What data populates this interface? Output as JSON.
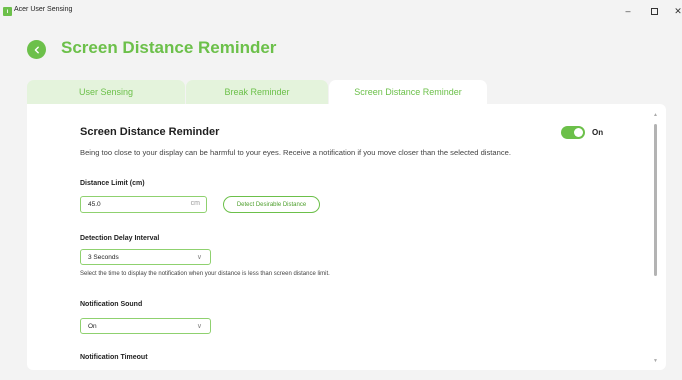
{
  "window": {
    "title": "Acer User Sensing",
    "minimize_glyph": "–",
    "close_glyph": "✕"
  },
  "header": {
    "back_glyph": "‹",
    "title": "Screen Distance Reminder"
  },
  "tabs": [
    {
      "label": "User Sensing",
      "active": false
    },
    {
      "label": "Break Reminder",
      "active": false
    },
    {
      "label": "Screen Distance Reminder",
      "active": true
    }
  ],
  "section": {
    "title": "Screen Distance Reminder",
    "toggle_label": "On",
    "toggle_on": true,
    "description": "Being too close to your display can be harmful to your eyes. Receive a notification if you move closer than the selected distance."
  },
  "distance_limit": {
    "label": "Distance Limit (cm)",
    "value": "45.0",
    "unit": "cm",
    "detect_button": "Detect Desirable Distance"
  },
  "detection_delay": {
    "label": "Detection Delay Interval",
    "selected": "3 Seconds",
    "hint": "Select the time to display the notification when your distance is less than screen distance limit."
  },
  "notification_sound": {
    "label": "Notification Sound",
    "selected": "On"
  },
  "notification_timeout": {
    "label": "Notification Timeout"
  },
  "colors": {
    "accent": "#6cc04a",
    "tab_inactive_bg": "#e4f3dc",
    "background": "#f3f3f3"
  },
  "icons": {
    "chevron": "∨",
    "scroll_up": "▲",
    "scroll_down": "▼"
  }
}
